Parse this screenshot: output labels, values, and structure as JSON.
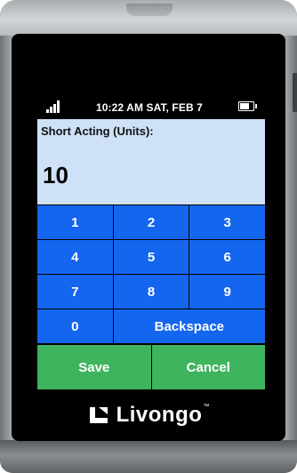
{
  "status_bar": {
    "signal_icon": "signal-bars-icon",
    "time_date": "10:22 AM SAT, FEB 7",
    "battery_icon": "battery-icon"
  },
  "entry": {
    "label": "Short Acting (Units):",
    "value": "10"
  },
  "keypad": {
    "keys": [
      "1",
      "2",
      "3",
      "4",
      "5",
      "6",
      "7",
      "8",
      "9",
      "0"
    ],
    "backspace": "Backspace"
  },
  "actions": {
    "save": "Save",
    "cancel": "Cancel"
  },
  "brand": {
    "name": "Livongo",
    "trademark": "™"
  },
  "colors": {
    "keypad": "#1466ee",
    "action": "#3fb45f",
    "display": "#cfe1f6",
    "screen": "#000000"
  }
}
